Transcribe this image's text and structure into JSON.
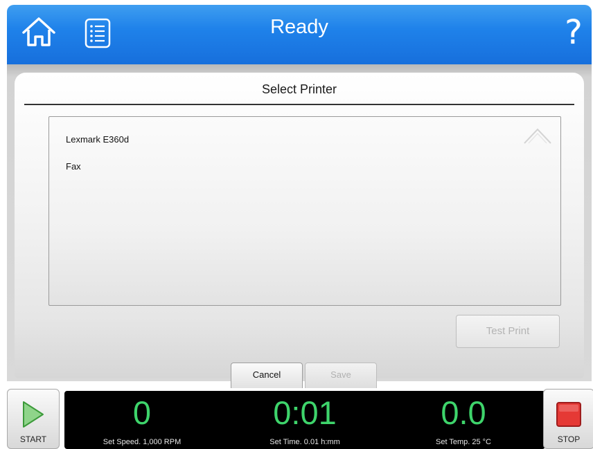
{
  "header": {
    "title": "Ready",
    "help_glyph": "?",
    "icons": {
      "home": "home-icon",
      "menu": "menu-list-icon",
      "help": "help-icon"
    }
  },
  "dialog": {
    "title": "Select Printer",
    "printers": [
      "Lexmark E360d",
      "Fax"
    ],
    "test_print_label": "Test Print",
    "cancel_label": "Cancel",
    "save_label": "Save"
  },
  "controls": {
    "start_label": "START",
    "stop_label": "STOP"
  },
  "status": {
    "speed_value": "0",
    "speed_label": "Set Speed. 1,000 RPM",
    "time_value": "0:01",
    "time_label": "Set Time. 0.01 h:mm",
    "temp_value": "0.0",
    "temp_label": "Set Temp. 25 °C"
  },
  "colors": {
    "header_blue": "#1f82ea",
    "readout_green": "#3ed46b",
    "start_green": "#4caf50",
    "stop_red": "#e53935"
  }
}
